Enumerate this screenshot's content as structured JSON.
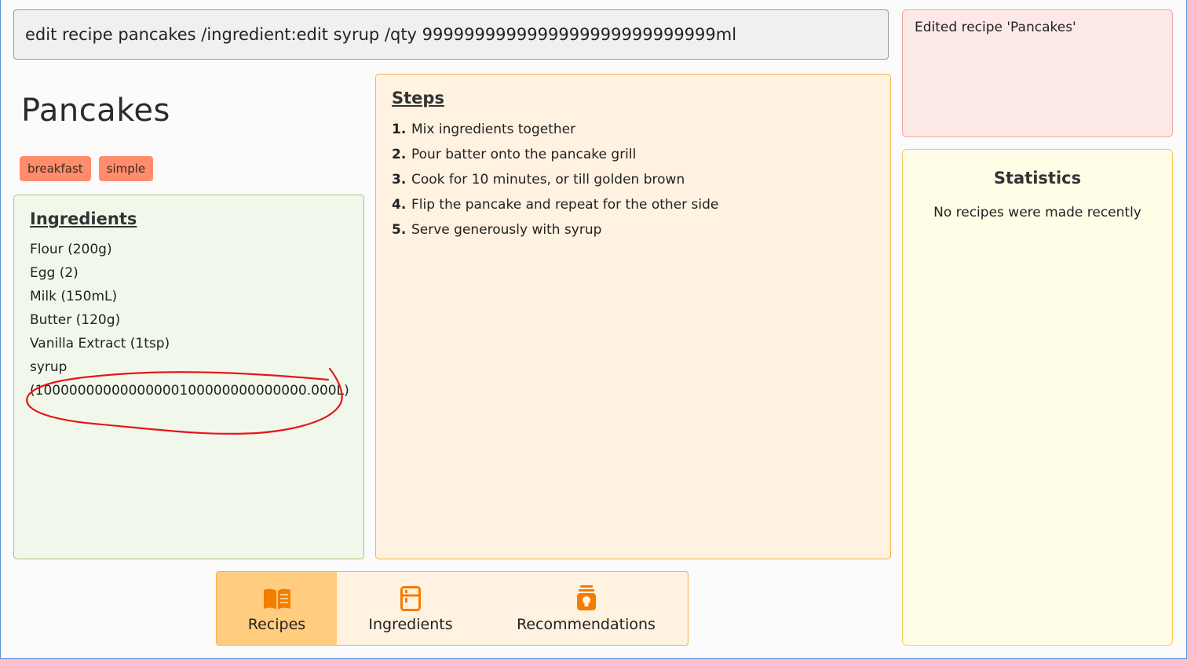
{
  "command": {
    "value": "edit recipe pancakes /ingredient:edit syrup /qty 9999999999999999999999999999ml"
  },
  "result": {
    "message": "Edited recipe 'Pancakes'"
  },
  "recipe": {
    "title": "Pancakes",
    "tags": [
      "breakfast",
      "simple"
    ],
    "ingredients_heading": "Ingredients",
    "ingredients": [
      "Flour (200g)",
      "Egg (2)",
      "Milk (150mL)",
      "Butter (120g)",
      "Vanilla Extract (1tsp)",
      "syrup (10000000000000000100000000000000.000L)"
    ],
    "steps_heading": "Steps",
    "steps": [
      {
        "num": "1.",
        "text": "Mix ingredients together"
      },
      {
        "num": "2.",
        "text": "Pour batter onto the pancake grill"
      },
      {
        "num": "3.",
        "text": "Cook for 10 minutes, or till golden brown"
      },
      {
        "num": "4.",
        "text": "Flip the pancake and repeat for the other side"
      },
      {
        "num": "5.",
        "text": "Serve generously with syrup"
      }
    ]
  },
  "statistics": {
    "title": "Statistics",
    "text": "No recipes were made recently"
  },
  "tabs": [
    {
      "label": "Recipes",
      "icon": "book-icon",
      "active": true
    },
    {
      "label": "Ingredients",
      "icon": "fridge-icon",
      "active": false
    },
    {
      "label": "Recommendations",
      "icon": "jar-lightbulb-icon",
      "active": false
    }
  ],
  "colors": {
    "tag": "#ff8c6b",
    "tab_icon": "#f57c00",
    "annotation": "#e8141c"
  }
}
